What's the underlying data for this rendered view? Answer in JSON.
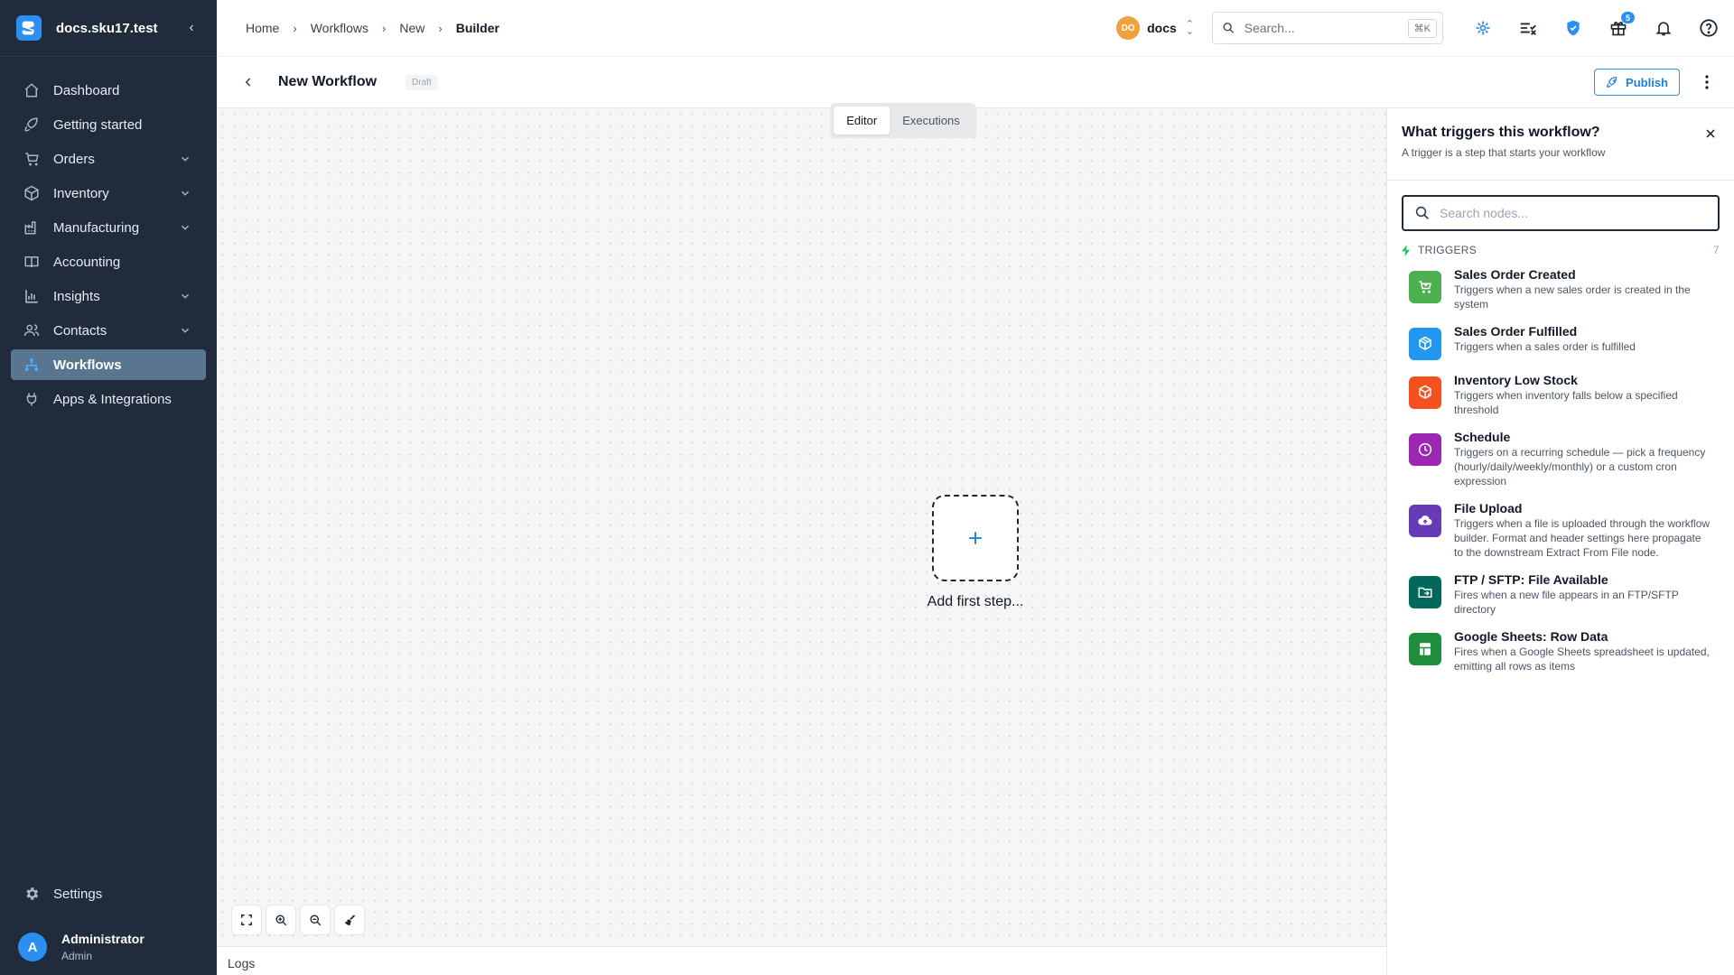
{
  "sidebar": {
    "brand": "docs.sku17.test",
    "items": [
      {
        "label": "Dashboard",
        "icon": "home-icon",
        "expand": false,
        "active": false
      },
      {
        "label": "Getting started",
        "icon": "rocket-icon",
        "expand": false,
        "active": false
      },
      {
        "label": "Orders",
        "icon": "cart-icon",
        "expand": true,
        "active": false
      },
      {
        "label": "Inventory",
        "icon": "box-icon",
        "expand": true,
        "active": false
      },
      {
        "label": "Manufacturing",
        "icon": "factory-icon",
        "expand": true,
        "active": false
      },
      {
        "label": "Accounting",
        "icon": "book-icon",
        "expand": false,
        "active": false
      },
      {
        "label": "Insights",
        "icon": "bar-chart-icon",
        "expand": true,
        "active": false
      },
      {
        "label": "Contacts",
        "icon": "users-icon",
        "expand": true,
        "active": false
      },
      {
        "label": "Workflows",
        "icon": "workflow-icon",
        "expand": false,
        "active": true
      },
      {
        "label": "Apps & Integrations",
        "icon": "plug-icon",
        "expand": false,
        "active": false
      }
    ],
    "settings_label": "Settings",
    "user": {
      "initial": "A",
      "name": "Administrator",
      "role": "Admin"
    }
  },
  "topbar": {
    "breadcrumbs": [
      "Home",
      "Workflows",
      "New",
      "Builder"
    ],
    "org_initials": "DO",
    "org_name": "docs",
    "search_placeholder": "Search...",
    "search_shortcut": "⌘K",
    "gift_badge": "5"
  },
  "workflow": {
    "title": "New Workflow",
    "status": "Draft",
    "publish_label": "Publish",
    "tabs": [
      "Editor",
      "Executions"
    ],
    "active_tab": "Editor",
    "add_step_label": "Add first step...",
    "logs_label": "Logs"
  },
  "panel": {
    "title": "What triggers this workflow?",
    "subtitle": "A trigger is a step that starts your workflow",
    "search_placeholder": "Search nodes...",
    "section_label": "TRIGGERS",
    "section_count": "7",
    "nodes": [
      {
        "name": "Sales Order Created",
        "desc": "Triggers when a new sales order is created in the system",
        "color": "#4caf50",
        "icon": "cart-plus-icon"
      },
      {
        "name": "Sales Order Fulfilled",
        "desc": "Triggers when a sales order is fulfilled",
        "color": "#2196f3",
        "icon": "package-icon"
      },
      {
        "name": "Inventory Low Stock",
        "desc": "Triggers when inventory falls below a specified threshold",
        "color": "#f4511e",
        "icon": "package-alert-icon"
      },
      {
        "name": "Schedule",
        "desc": "Triggers on a recurring schedule — pick a frequency (hourly/daily/weekly/monthly) or a custom cron expression",
        "color": "#9c27b0",
        "icon": "clock-icon"
      },
      {
        "name": "File Upload",
        "desc": "Triggers when a file is uploaded through the workflow builder. Format and header settings here propagate to the downstream Extract From File node.",
        "color": "#673ab7",
        "icon": "cloud-upload-icon"
      },
      {
        "name": "FTP / SFTP: File Available",
        "desc": "Fires when a new file appears in an FTP/SFTP directory",
        "color": "#00695c",
        "icon": "folder-icon"
      },
      {
        "name": "Google Sheets: Row Data",
        "desc": "Fires when a Google Sheets spreadsheet is updated, emitting all rows as items",
        "color": "#1e8e3e",
        "icon": "sheet-icon"
      }
    ]
  },
  "colors": {
    "sidebar_bg": "#202b3c",
    "accent": "#2a8ff0",
    "active_nav": "#5a7590"
  }
}
